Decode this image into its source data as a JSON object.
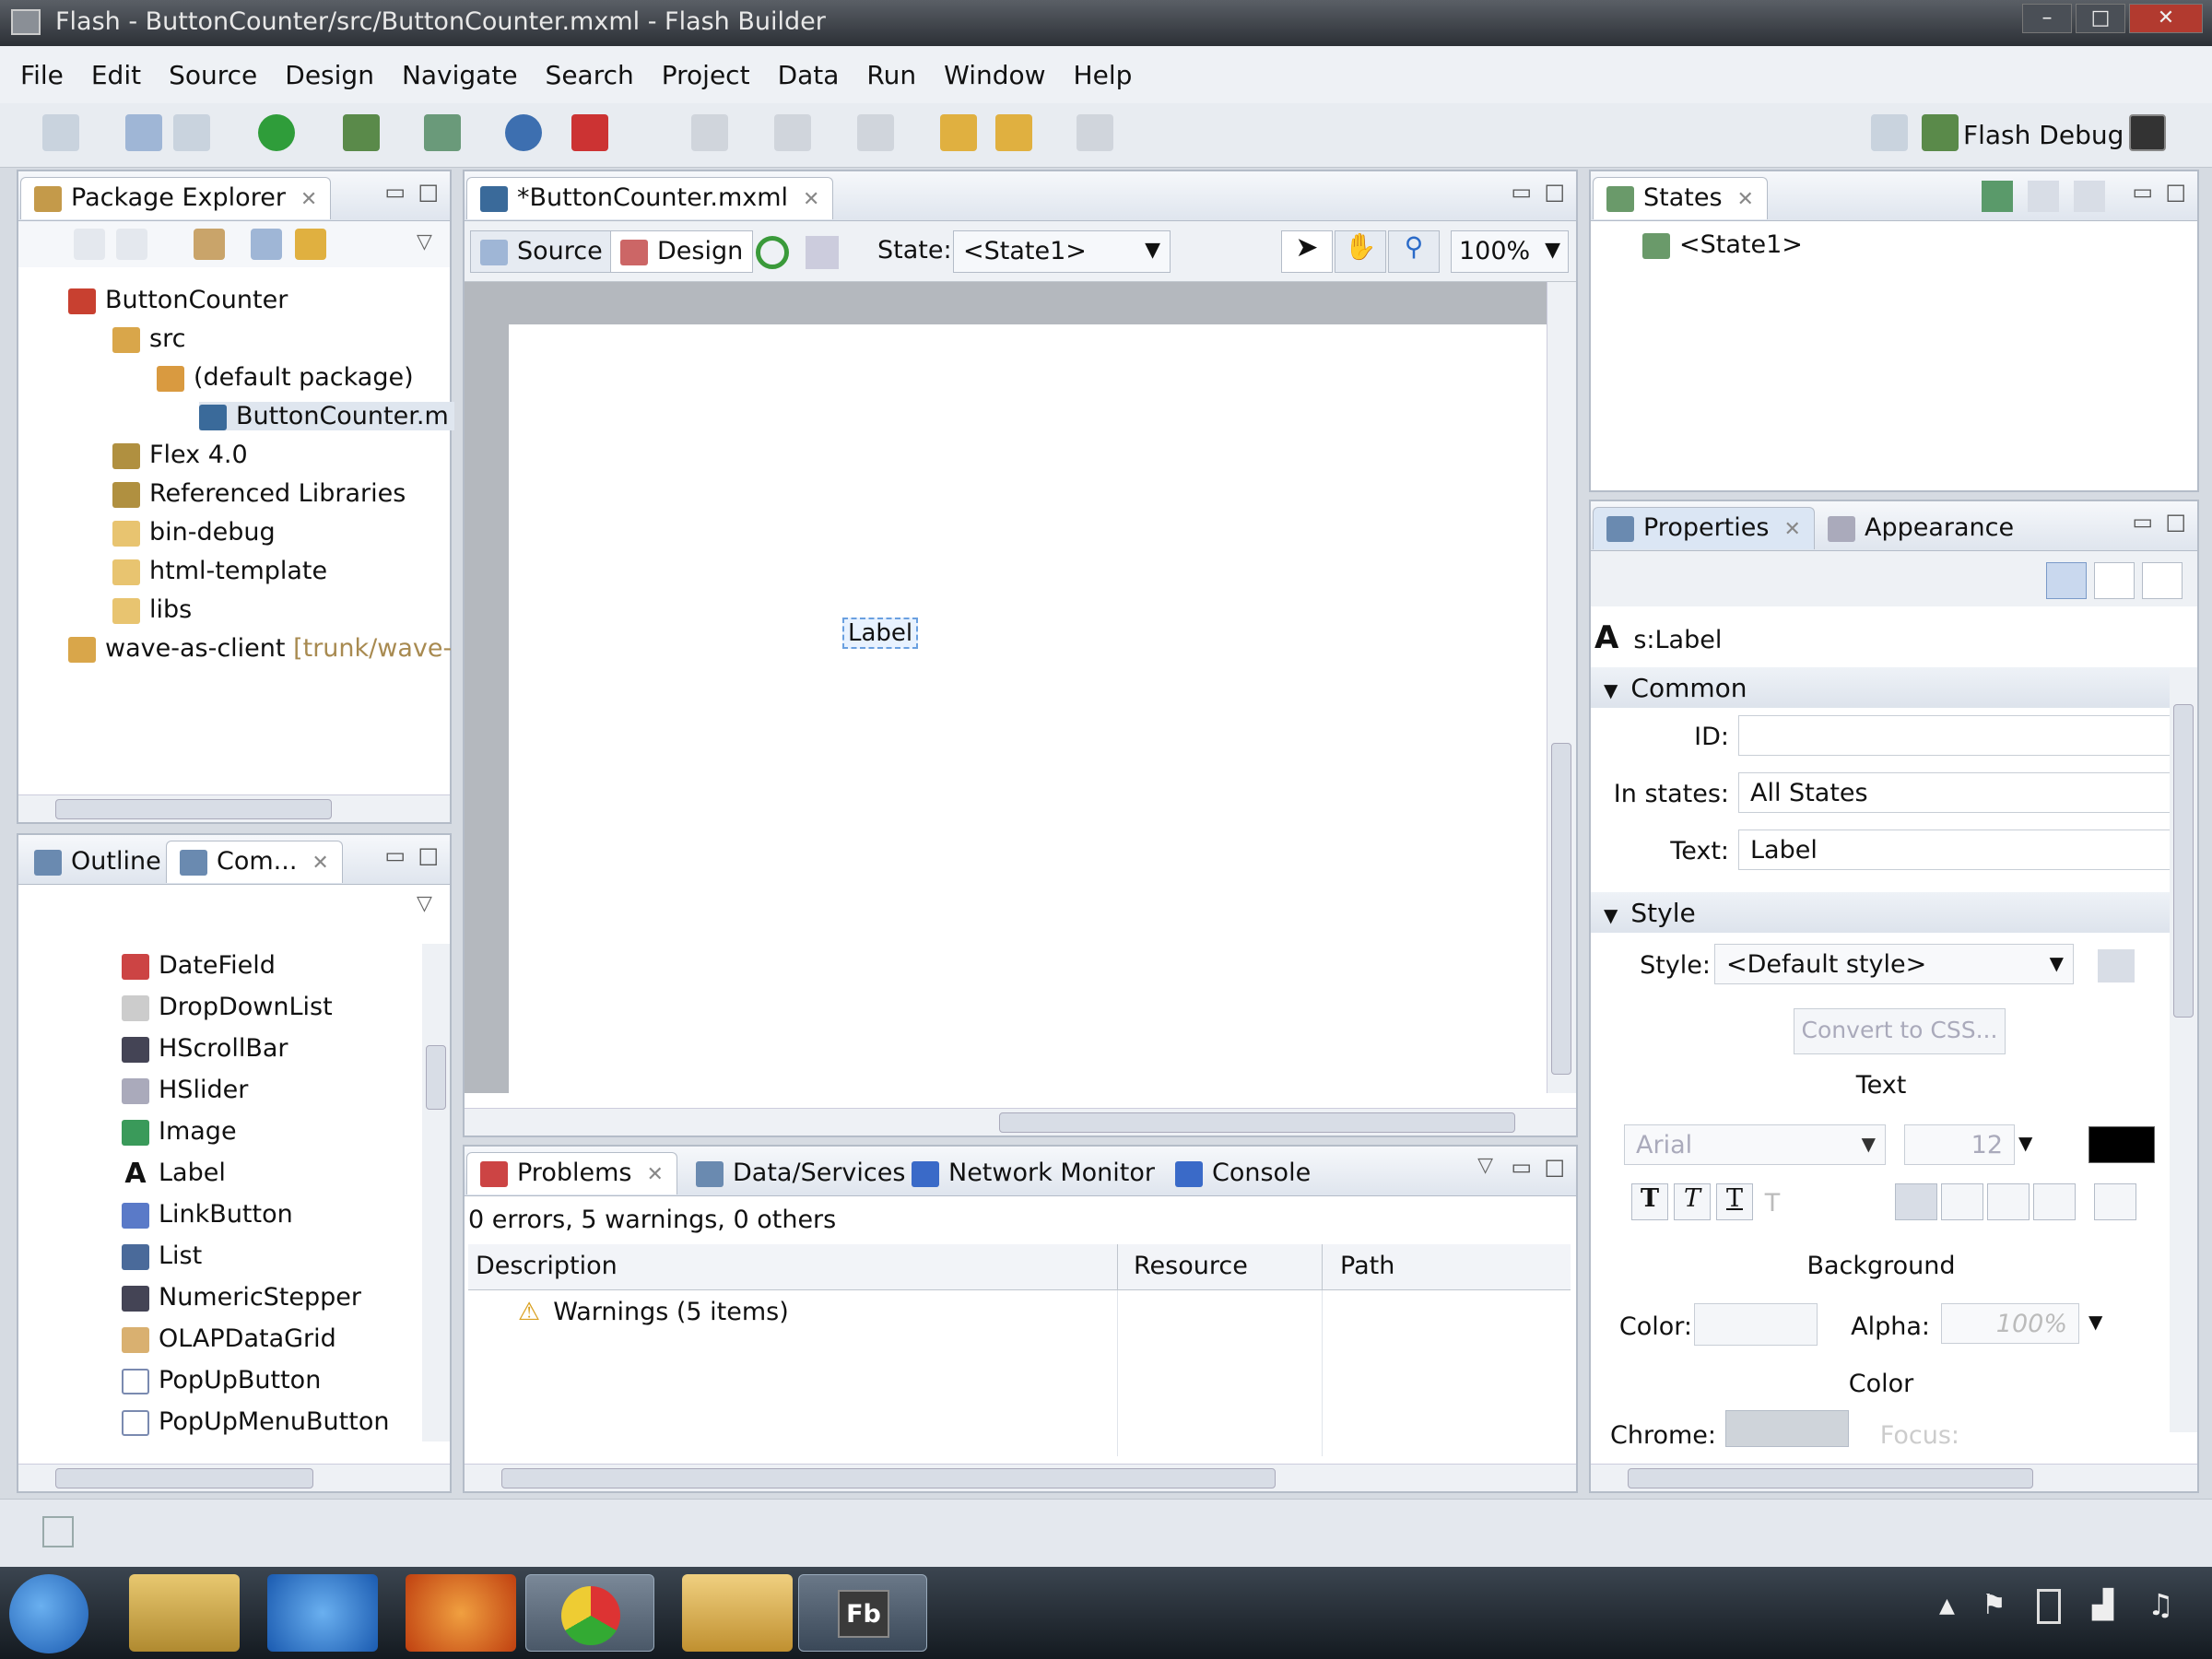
{
  "window": {
    "title": "Flash - ButtonCounter/src/ButtonCounter.mxml - Flash Builder"
  },
  "menu": [
    "File",
    "Edit",
    "Source",
    "Design",
    "Navigate",
    "Search",
    "Project",
    "Data",
    "Run",
    "Window",
    "Help"
  ],
  "perspective": {
    "label": "Flash Debug"
  },
  "package_explorer": {
    "tab": "Package Explorer",
    "items": [
      {
        "label": "ButtonCounter",
        "icon": "project-icon"
      },
      {
        "label": "src",
        "icon": "source-folder-icon"
      },
      {
        "label": "(default package)",
        "icon": "package-icon"
      },
      {
        "label": "ButtonCounter.m",
        "icon": "mxml-file-icon"
      },
      {
        "label": "Flex 4.0",
        "icon": "library-icon"
      },
      {
        "label": "Referenced Libraries",
        "icon": "library-icon"
      },
      {
        "label": "bin-debug",
        "icon": "folder-icon"
      },
      {
        "label": "html-template",
        "icon": "folder-icon"
      },
      {
        "label": "libs",
        "icon": "folder-icon"
      },
      {
        "label": "wave-as-client",
        "suffix": "[trunk/wave-",
        "icon": "project-icon"
      }
    ]
  },
  "components": {
    "tabs": [
      "Outline",
      "Com..."
    ],
    "items": [
      "DateField",
      "DropDownList",
      "HScrollBar",
      "HSlider",
      "Image",
      "Label",
      "LinkButton",
      "List",
      "NumericStepper",
      "OLAPDataGrid",
      "PopUpButton",
      "PopUpMenuButton"
    ]
  },
  "editor": {
    "tab": "*ButtonCounter.mxml",
    "source_btn": "Source",
    "design_btn": "Design",
    "state_label": "State:",
    "state_value": "<State1>",
    "zoom": "100%",
    "canvas_label": "Label"
  },
  "bottom": {
    "tabs": [
      "Problems",
      "Data/Services",
      "Network Monitor",
      "Console"
    ],
    "summary": "0 errors, 5 warnings, 0 others",
    "columns": [
      "Description",
      "Resource",
      "Path"
    ],
    "rows": [
      {
        "description": "Warnings (5 items)"
      }
    ]
  },
  "states": {
    "tab": "States",
    "items": [
      "<State1>"
    ]
  },
  "properties": {
    "tabs": [
      "Properties",
      "Appearance"
    ],
    "component": "s:Label",
    "common": {
      "section": "Common",
      "id_label": "ID:",
      "id_value": "",
      "states_label": "In states:",
      "states_value": "All States",
      "text_label": "Text:",
      "text_value": "Label"
    },
    "style": {
      "section": "Style",
      "style_label": "Style:",
      "style_value": "<Default style>",
      "convert_btn": "Convert to CSS...",
      "text_header": "Text",
      "font": "Arial",
      "size": "12",
      "background_header": "Background",
      "color_label": "Color:",
      "alpha_label": "Alpha:",
      "alpha_value": "100%",
      "color_header": "Color",
      "chrome_label": "Chrome:",
      "focus_label": "Focus:"
    }
  },
  "taskbar": {
    "fb_label": "Fb"
  }
}
